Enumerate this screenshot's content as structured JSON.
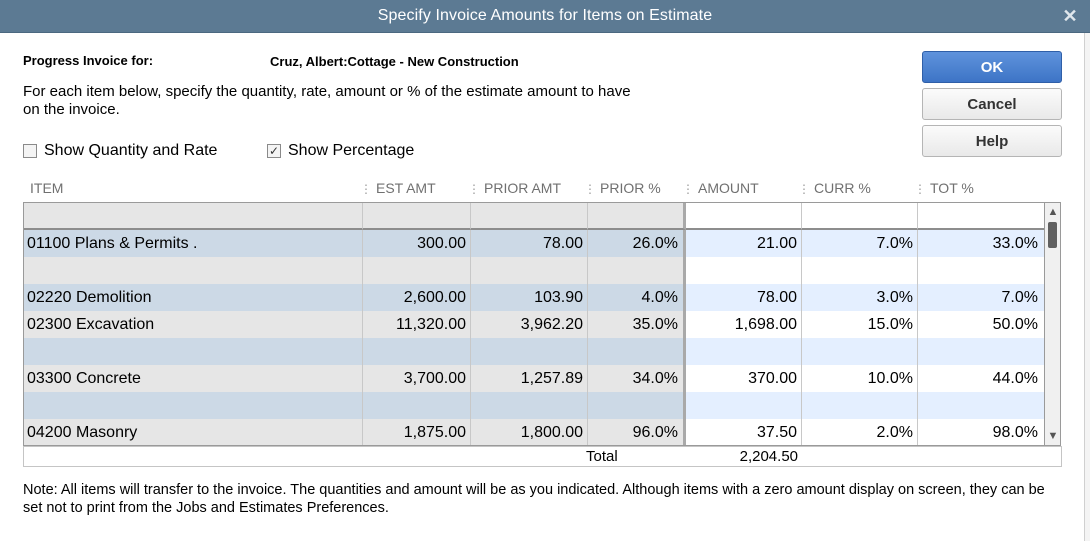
{
  "window": {
    "title": "Specify Invoice Amounts for Items on Estimate",
    "close_glyph": "✕"
  },
  "header": {
    "progress_label": "Progress Invoice for:",
    "customer": "Cruz, Albert:Cottage - New Construction",
    "instructions": "For each item below, specify the quantity, rate, amount or % of the estimate amount to have on the invoice."
  },
  "options": {
    "show_qty_rate": {
      "label": "Show Quantity and Rate",
      "checked": false
    },
    "show_percentage": {
      "label": "Show Percentage",
      "checked": true
    }
  },
  "buttons": {
    "ok": "OK",
    "cancel": "Cancel",
    "help": "Help"
  },
  "columns": {
    "item": "ITEM",
    "est_amt": "EST AMT",
    "prior_amt": "PRIOR AMT",
    "prior_pct": "PRIOR %",
    "amount": "AMOUNT",
    "curr_pct": "CURR %",
    "tot_pct": "TOT %"
  },
  "rows": [
    {
      "item": "",
      "est": "",
      "prior": "",
      "ppct": "",
      "amt": "",
      "curr": "",
      "tot": ""
    },
    {
      "item": "01100 Plans & Permits  .",
      "est": "300.00",
      "prior": "78.00",
      "ppct": "26.0%",
      "amt": "21.00",
      "curr": "7.0%",
      "tot": "33.0%"
    },
    {
      "item": "",
      "est": "",
      "prior": "",
      "ppct": "",
      "amt": "",
      "curr": "",
      "tot": ""
    },
    {
      "item": "02220 Demolition",
      "est": "2,600.00",
      "prior": "103.90",
      "ppct": "4.0%",
      "amt": "78.00",
      "curr": "3.0%",
      "tot": "7.0%"
    },
    {
      "item": "02300 Excavation",
      "est": "11,320.00",
      "prior": "3,962.20",
      "ppct": "35.0%",
      "amt": "1,698.00",
      "curr": "15.0%",
      "tot": "50.0%"
    },
    {
      "item": "",
      "est": "",
      "prior": "",
      "ppct": "",
      "amt": "",
      "curr": "",
      "tot": ""
    },
    {
      "item": "03300 Concrete",
      "est": "3,700.00",
      "prior": "1,257.89",
      "ppct": "34.0%",
      "amt": "370.00",
      "curr": "10.0%",
      "tot": "44.0%"
    },
    {
      "item": "",
      "est": "",
      "prior": "",
      "ppct": "",
      "amt": "",
      "curr": "",
      "tot": ""
    },
    {
      "item": "04200 Masonry",
      "est": "1,875.00",
      "prior": "1,800.00",
      "ppct": "96.0%",
      "amt": "37.50",
      "curr": "2.0%",
      "tot": "98.0%"
    }
  ],
  "totals": {
    "label": "Total",
    "amount": "2,204.50"
  },
  "note": "Note: All items will transfer to the invoice. The quantities and amount will be as you indicated. Although items with a zero amount display on screen, they can be set not to print from the Jobs and Estimates Preferences."
}
